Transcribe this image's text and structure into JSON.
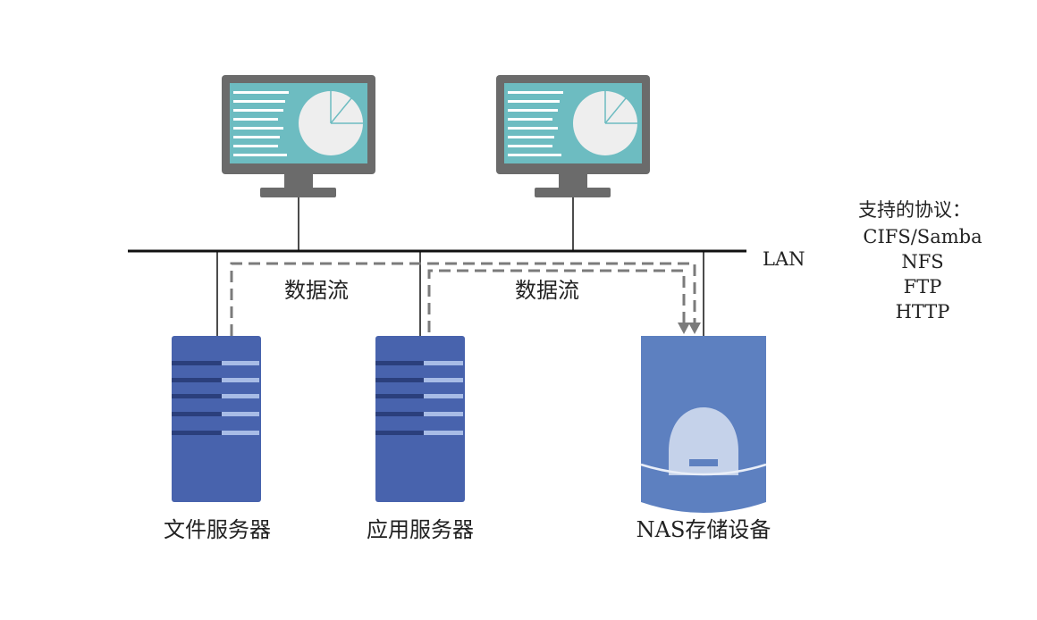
{
  "network": {
    "lan_label": "LAN",
    "data_flow_label_1": "数据流",
    "data_flow_label_2": "数据流"
  },
  "devices": {
    "file_server_label": "文件服务器",
    "app_server_label": "应用服务器",
    "nas_label": "NAS存储设备"
  },
  "protocols": {
    "title": "支持的协议：",
    "items": [
      "CIFS/Samba",
      "NFS",
      "FTP",
      "HTTP"
    ]
  },
  "colors": {
    "monitor_frame": "#6b6b6b",
    "screen": "#6dbcc1",
    "server_blue": "#4863ad",
    "server_dark_slot": "#2b3f7c",
    "server_light_slot": "#a8bce6",
    "nas_blue": "#5d80c0",
    "nas_light": "#c5d2ea",
    "flow_dash": "#7b7b7b",
    "line": "#111111"
  }
}
